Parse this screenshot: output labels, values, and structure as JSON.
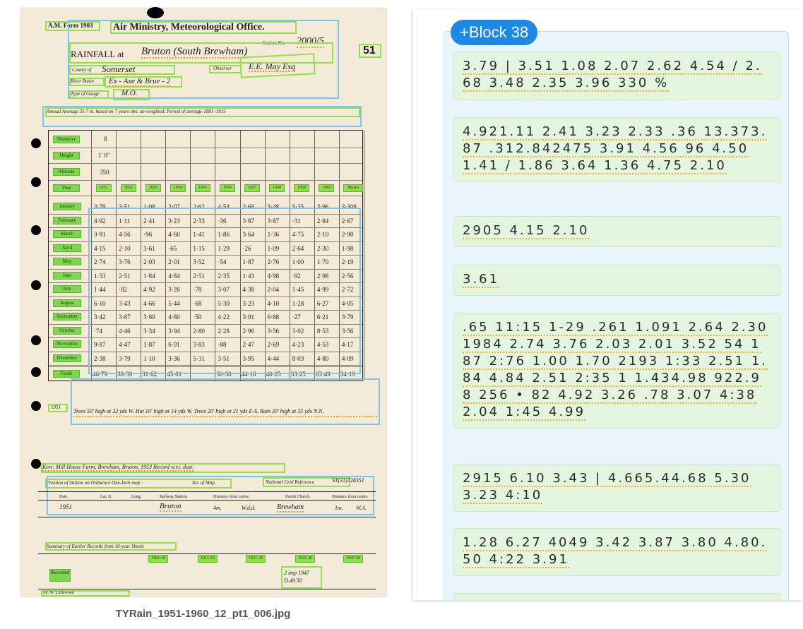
{
  "document": {
    "filename": "TYRain_1951-1960_12_pt1_006.jpg",
    "form_id": "A.M. Form 1903",
    "heading": "Air Ministry, Meteorological Office.",
    "station_no_label": "Station No.",
    "station_no": "2000/5",
    "page_number": "51",
    "rainfall_at_label": "RAINFALL at",
    "station_name": "Bruton (South Brewham)",
    "county_label": "County of",
    "county": "Somerset",
    "observer_label": "Observer",
    "observer": "E.E. May Esq",
    "river_basin_label": "River Basin",
    "river_basin": "Ex - Axe & Brue - 2",
    "type_of_gauge_label": "Type of Gauge",
    "type_of_gauge": "M.O.",
    "annual_average_line": "Annual Average 35·7 in. based on 7 years obs. un-weighted.  Period of average 1881–1915",
    "row_labels_top": [
      "Diameter",
      "Height",
      "Altitude",
      "Year"
    ],
    "diameter_value": "8",
    "height_value": "1' 0\"",
    "altitude_value": "350",
    "years": [
      "1951",
      "1952",
      "1953",
      "1954",
      "1955",
      "1956",
      "1957",
      "1958",
      "1959",
      "1960",
      "Means"
    ],
    "months": [
      "January",
      "February",
      "March",
      "April",
      "May",
      "June",
      "July",
      "August",
      "September",
      "October",
      "November",
      "December"
    ],
    "totals_label": "Totals",
    "values": [
      [
        "3·79",
        "3·51",
        "1·08",
        "2·07",
        "2·62",
        "4·54",
        "2·68",
        "3·48",
        "5·35",
        "3·96",
        "3·308"
      ],
      [
        "4·92",
        "1·11",
        "2·41",
        "3·23",
        "2·33",
        "·36",
        "3·87",
        "3·87",
        "·31",
        "2·84",
        "2·67"
      ],
      [
        "3·91",
        "4·56",
        "·96",
        "4·60",
        "1·41",
        "1·86",
        "3·64",
        "1·36",
        "4·75",
        "2·10",
        "2·90"
      ],
      [
        "4·15",
        "2·10",
        "3·61",
        "·65",
        "1·15",
        "1·29",
        "·26",
        "1·09",
        "2·64",
        "2·30",
        "1·98"
      ],
      [
        "2·74",
        "3·76",
        "2·03",
        "2·01",
        "3·52",
        "·54",
        "1·87",
        "2·76",
        "1·00",
        "1·70",
        "2·19"
      ],
      [
        "1·33",
        "2·51",
        "1·84",
        "4·84",
        "2·51",
        "2·35",
        "1·43",
        "4·98",
        "·92",
        "2·98",
        "2·56"
      ],
      [
        "1·44",
        "·82",
        "4·92",
        "3·26",
        "·78",
        "3·07",
        "4·38",
        "2·04",
        "1·45",
        "4·99",
        "2·72"
      ],
      [
        "6·10",
        "3·43",
        "4·66",
        "5·44",
        "·68",
        "5·30",
        "3·23",
        "4·10",
        "1·28",
        "6·27",
        "4·05"
      ],
      [
        "3·42",
        "3·87",
        "3·80",
        "4·80",
        "·50",
        "4·22",
        "3·91",
        "6·88",
        "·27",
        "6·21",
        "3·79"
      ],
      [
        "·74",
        "4·46",
        "3·34",
        "3·94",
        "2·80",
        "2·28",
        "2·96",
        "3·56",
        "3·02",
        "8·53",
        "3·56"
      ],
      [
        "9·87",
        "4·47",
        "1·87",
        "6·91",
        "3·83",
        "·88",
        "2·47",
        "2·69",
        "4·23",
        "4·53",
        "4·17"
      ],
      [
        "2·38",
        "3·79",
        "1·10",
        "3·36",
        "5·31",
        "3·51",
        "3·95",
        "4·44",
        "8·03",
        "4·80",
        "4·09"
      ]
    ],
    "totals": [
      "46·79",
      "38·39",
      "31·62",
      "45·01",
      "",
      "30·30",
      "44·16",
      "40·25",
      "33·25",
      "63·49",
      "34·19"
    ],
    "note_1951_label": "1951",
    "note_1951": "Trees 50' high at 32 yds W. Hut 10' high at 14 yds W. Trees 20' high at 21 yds E-S. Rain 30' high at 35 yds N.N.",
    "address_line": "Kew: Mill House Farm, Brewham, Bruton, 1953 Record w.r.t. dust.",
    "position_label": "Position of Station on Ordnance One-Inch map :",
    "no_of_map_label": "No. of Map.",
    "grid_ref_label": "National Grid Reference",
    "grid_ref": "ST(31)728351",
    "position_headers": [
      "Date.",
      "Lat. N.",
      "Long.",
      "Railway Station.",
      "Distance from centre.",
      "Parish Church.",
      "Distance from centre."
    ],
    "position_row": [
      "1951",
      "",
      "",
      "Bruton",
      "4m.",
      "W.d.d.",
      "Brewham",
      "1m.",
      "W.A."
    ],
    "summary_label": "Summary of Earlier Records from 10-year Sheets",
    "summary_years": [
      "1901-10",
      "1911-20",
      "1921-30",
      "1931-40",
      "1941-50"
    ],
    "summary_row_label": "Recorded",
    "summary_note": "2 imp 1947 D.49 50",
    "footer_label": "Att. W. Littlewood"
  },
  "ocr": {
    "block_label": "+Block 38",
    "lines": [
      "3.79 | 3.51 1.08 2.07 2.62 4.54 / 2.68 3.48 2.35 3.96 330 %",
      "4.921.11 2.41 3.23 2.33 .36 13.373.87 .312.842475 3.91 4.56 96 4.50 1.41 / 1.86 3.64 1.36 4.75 2.10",
      "2905 4.15 2.10",
      "3.61",
      ".65 11:15 1-29 .261 1.091 2.64 2.30 1984 2.74 3.76 2.03 2.01 3.52 54 1 87 2:76 1.00 1.70 2193 1:33 2.51 1.84 4.84 2.51 2:35 1 1.434.98 922.98 256 • 82 4.92 3.26 .78 3.07 4:38 2.04 1:45 4.99",
      "2915 6.10 3.43 | 4.665.44.68 5.30 3.23 4:10",
      "1.28 6.27 4049 3.42 3.87 3.80 4.80.50 4:22 3.91"
    ]
  }
}
